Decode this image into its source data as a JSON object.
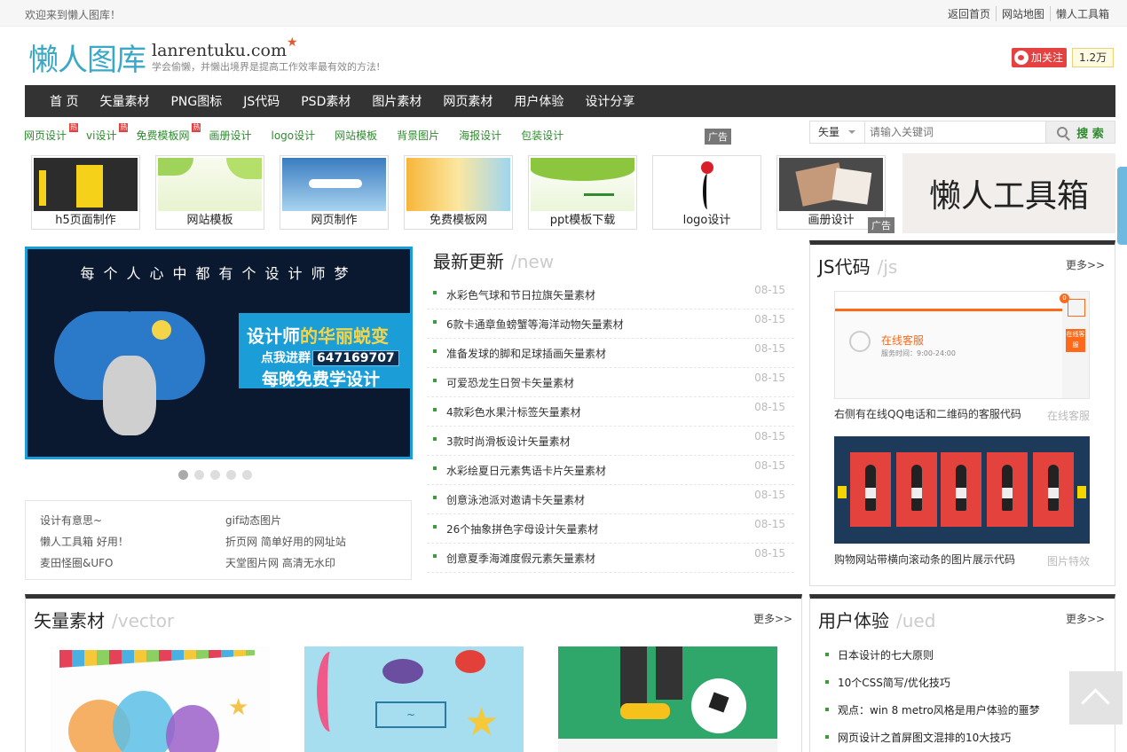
{
  "topbar": {
    "welcome": "欢迎来到懒人图库！",
    "links": [
      "返回首页",
      "网站地图",
      "懒人工具箱"
    ]
  },
  "header": {
    "logo": "懒人图库",
    "domain": "lanrentuku.com",
    "star": "★",
    "slogan": "学会偷懒，并懒出境界是提高工作效率最有效的方法!",
    "weibo_follow": "加关注",
    "weibo_count": "1.2万"
  },
  "nav": [
    "首 页",
    "矢量素材",
    "PNG图标",
    "JS代码",
    "PSD素材",
    "图片素材",
    "网页素材",
    "用户体验",
    "设计分享"
  ],
  "sublinks": [
    {
      "label": "网页设计",
      "hot": "热"
    },
    {
      "label": "vi设计",
      "hot": "热"
    },
    {
      "label": "免费模板网",
      "hot": "热"
    },
    {
      "label": "画册设计",
      "hot": ""
    },
    {
      "label": "logo设计",
      "hot": ""
    },
    {
      "label": "网站模板",
      "hot": ""
    },
    {
      "label": "背景图片",
      "hot": ""
    },
    {
      "label": "海报设计",
      "hot": ""
    },
    {
      "label": "包装设计",
      "hot": ""
    }
  ],
  "ad_label": "广告",
  "search": {
    "type": "矢量",
    "placeholder": "请输入关键词",
    "button": "搜 索"
  },
  "thumbs": [
    "h5页面制作",
    "网站模板",
    "网页制作",
    "免费模板网",
    "ppt模板下载",
    "logo设计",
    "画册设计"
  ],
  "tool_banner": "懒人工具箱",
  "slider": {
    "headline": "每个人心中都有个设计师梦",
    "title_pre": "设计师",
    "title_em": "的华丽蜕变",
    "qun_label": "点我进群",
    "qun_number": "647169707",
    "free": "每晚免费学设计"
  },
  "friends": [
    [
      "设计有意思~",
      "gif动态图片"
    ],
    [
      "懒人工具箱 好用！",
      "折页网 简单好用的网址站"
    ],
    [
      "麦田怪圈&UFO",
      "天堂图片网 高清无水印"
    ]
  ],
  "latest": {
    "title": "最新更新",
    "en": "/new",
    "items": [
      {
        "t": "水彩色气球和节日拉旗矢量素材",
        "d": "08-15"
      },
      {
        "t": "6款卡通章鱼螃蟹等海洋动物矢量素材",
        "d": "08-15"
      },
      {
        "t": "准备发球的脚和足球插画矢量素材",
        "d": "08-15"
      },
      {
        "t": "可爱恐龙生日贺卡矢量素材",
        "d": "08-15"
      },
      {
        "t": "4款彩色水果汁标签矢量素材",
        "d": "08-15"
      },
      {
        "t": "3款时尚滑板设计矢量素材",
        "d": "08-15"
      },
      {
        "t": "水彩绘夏日元素隽语卡片矢量素材",
        "d": "08-15"
      },
      {
        "t": "创意泳池派对邀请卡矢量素材",
        "d": "08-15"
      },
      {
        "t": "26个抽象拼色字母设计矢量素材",
        "d": "08-15"
      },
      {
        "t": "创意夏季海滩度假元素矢量素材",
        "d": "08-15"
      }
    ]
  },
  "js": {
    "title": "JS代码",
    "en": "/js",
    "more": "更多>>",
    "demo1": {
      "kefu": "在线客服",
      "time": "服务时间：9:00-24:00",
      "btn": "在线客服",
      "badge": "0"
    },
    "items": [
      {
        "cap": "右侧有在线QQ电话和二维码的客服代码",
        "tag": "在线客服"
      },
      {
        "cap": "购物网站带横向滚动条的图片展示代码",
        "tag": "图片特效"
      }
    ]
  },
  "vector": {
    "title": "矢量素材",
    "en": "/vector",
    "more": "更多>>"
  },
  "ued": {
    "title": "用户体验",
    "en": "/ued",
    "more": "更多>>",
    "items": [
      "日本设计的七大原则",
      "10个CSS简写/优化技巧",
      "观点：win 8 metro风格是用户体验的噩梦",
      "网页设计之首屏图文混排的10大技巧"
    ]
  },
  "colors": {
    "accent": "#3aa8c6",
    "green": "#2e8b2e",
    "nav": "#333333",
    "hot": "#e64141"
  }
}
